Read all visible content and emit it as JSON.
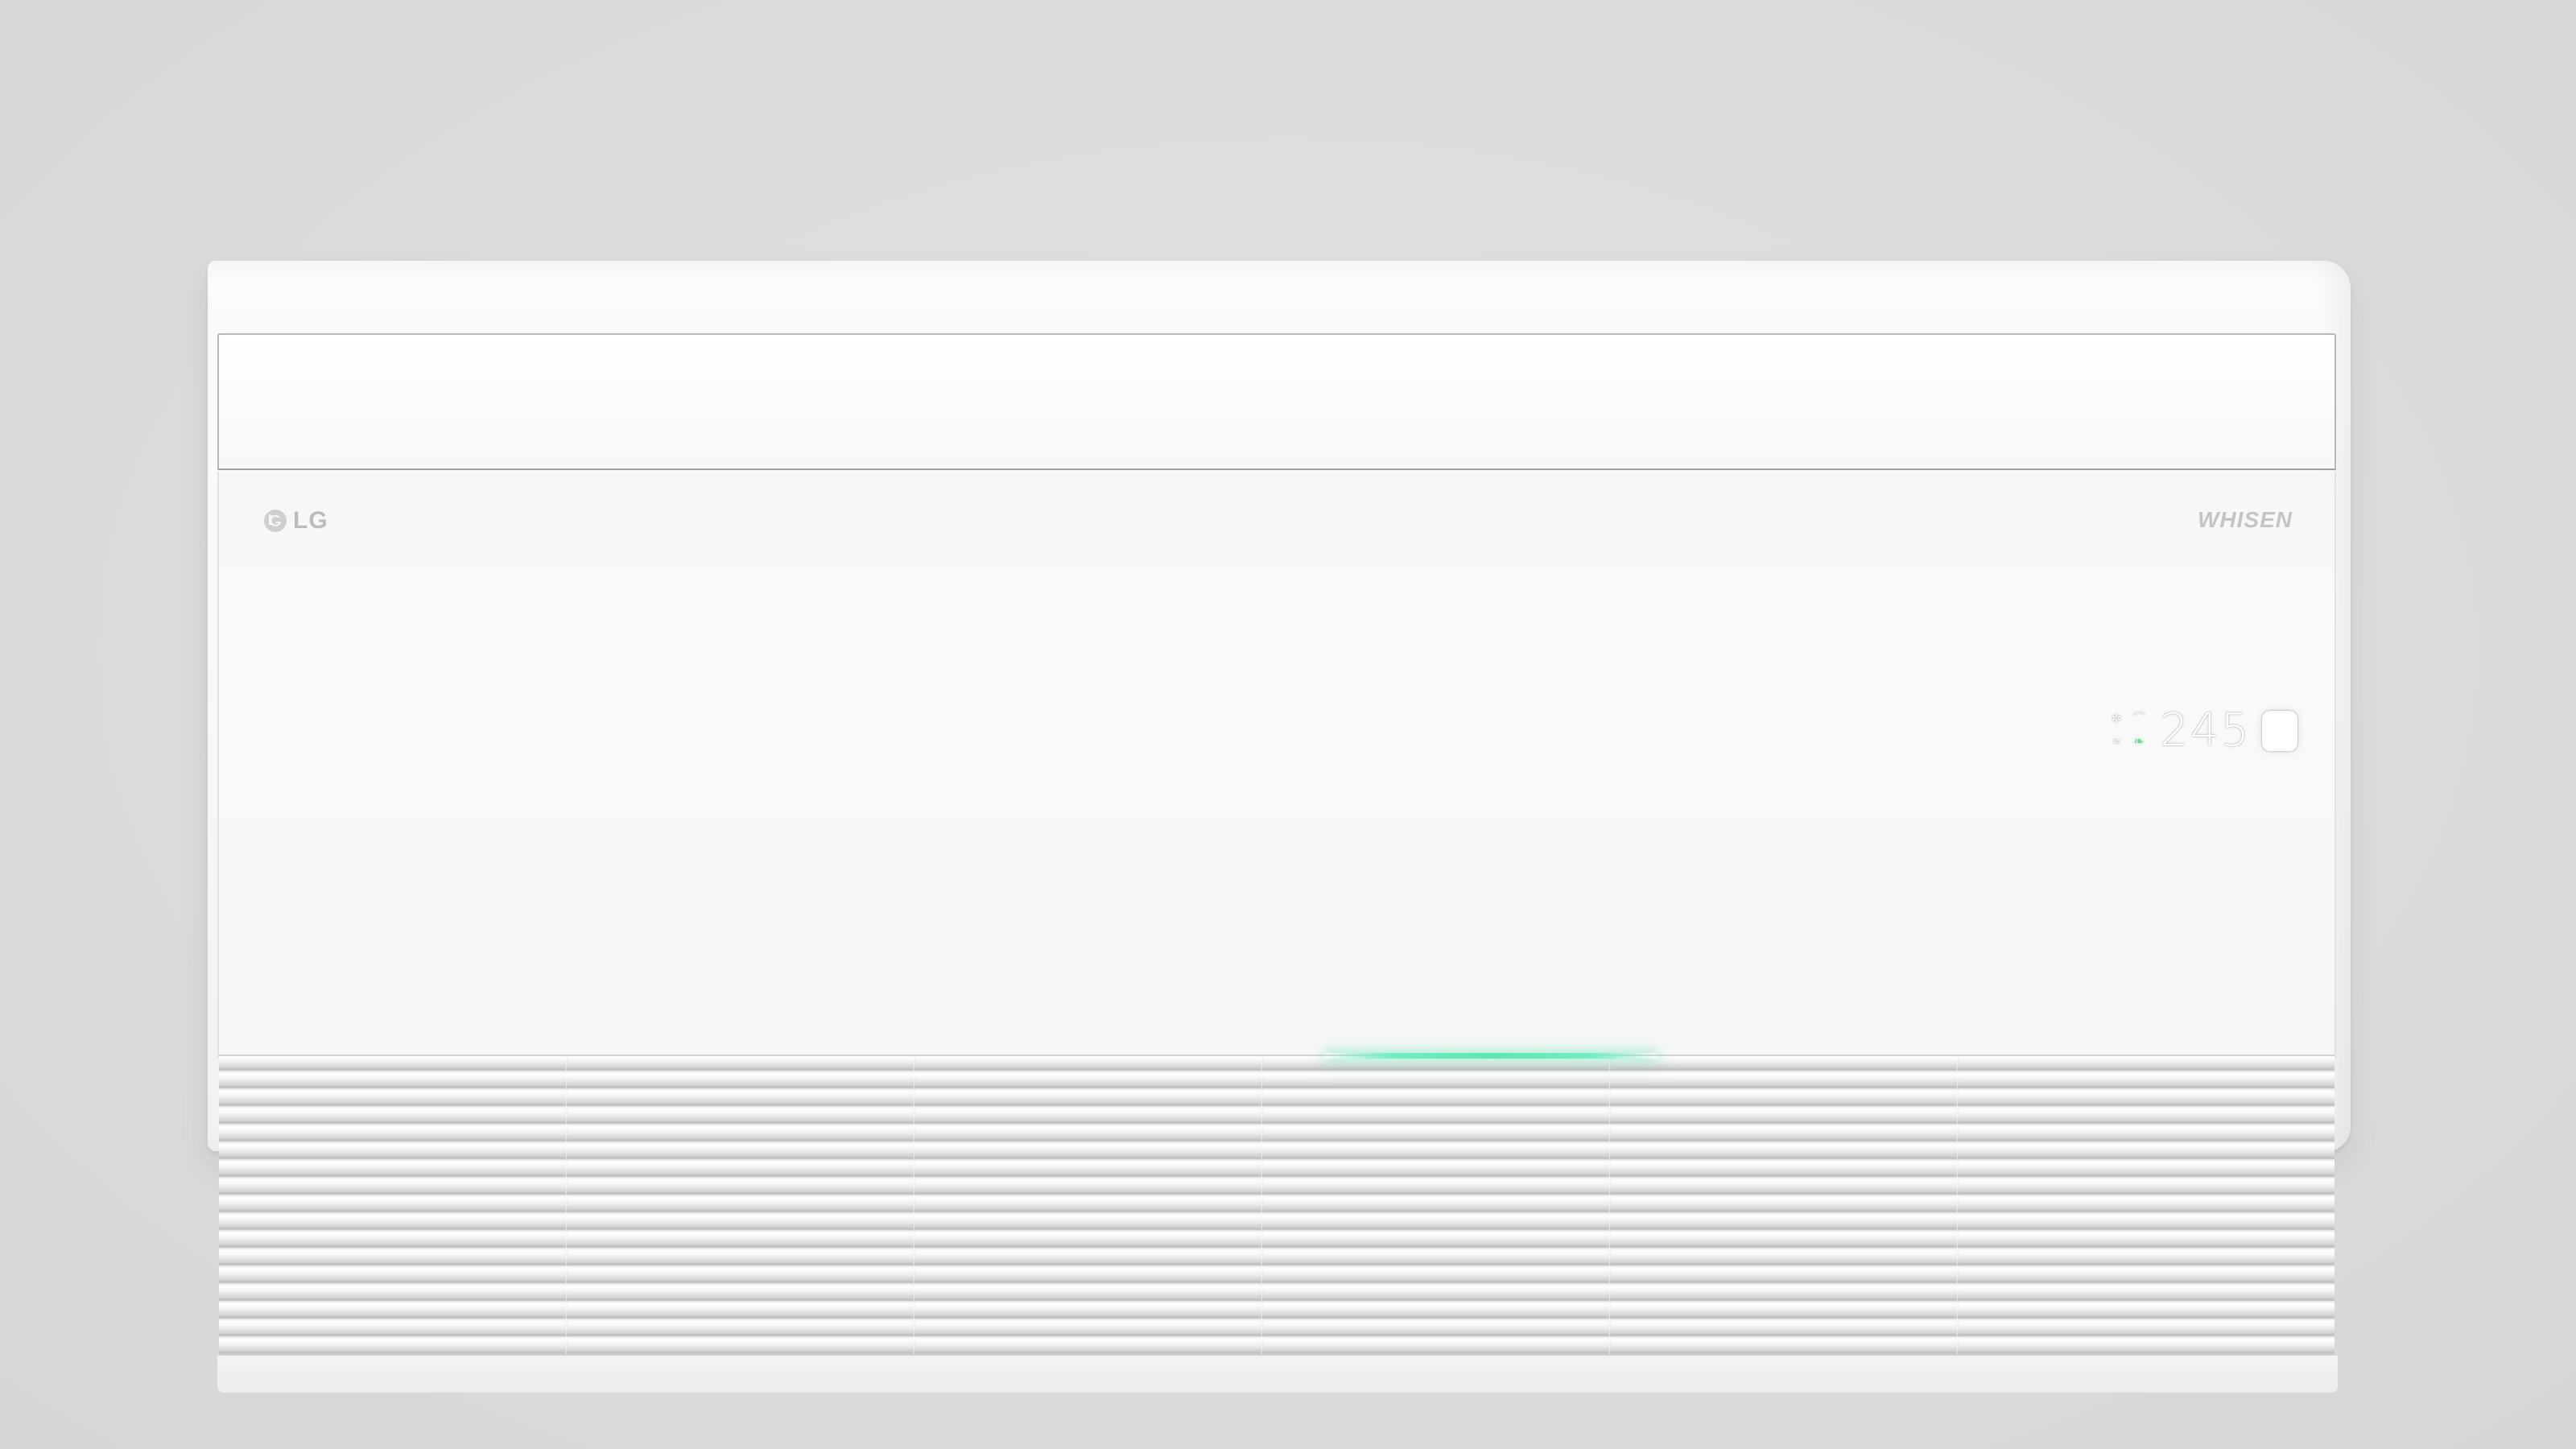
{
  "product": {
    "brand_logo": "LG",
    "model_logo": "WHISEN",
    "display": {
      "temperature": "245",
      "mode_icons": [
        "fan-icon",
        "swing-icon",
        "dehumidify-icon",
        "leaf-icon"
      ]
    },
    "status_light_color": "#5ee6b2"
  },
  "colors": {
    "background": "#dcdcdc",
    "body": "#f7f7f7",
    "accent_light": "#5ee6b2"
  }
}
